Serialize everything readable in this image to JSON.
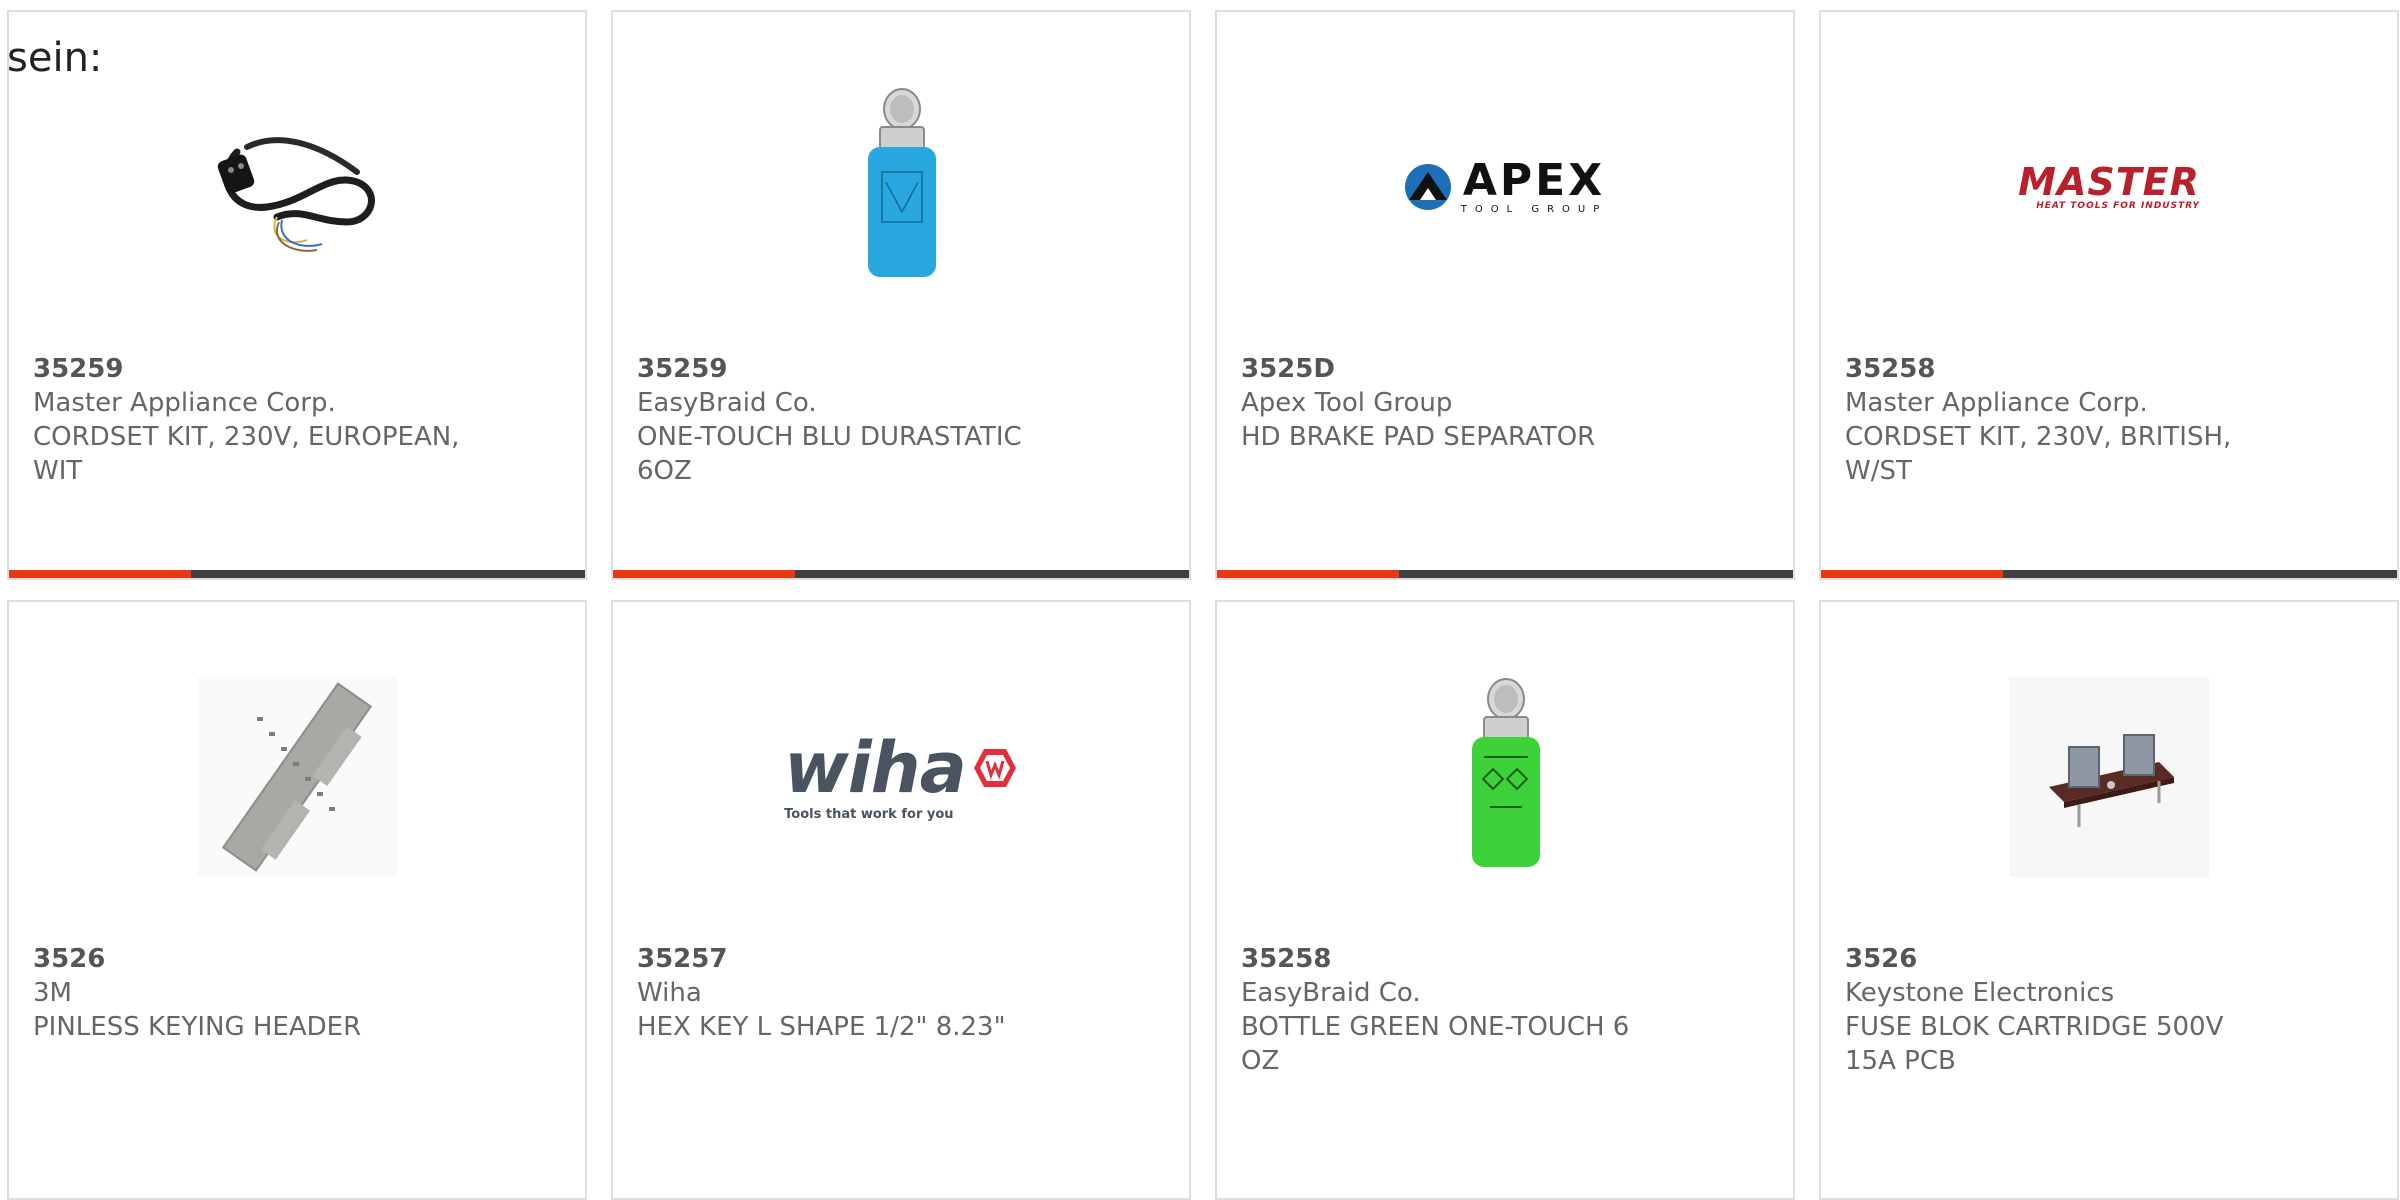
{
  "intro_text": "sein:",
  "products": [
    {
      "part": "35259",
      "maker": "Master Appliance Corp.",
      "desc": "CORDSET KIT, 230V, EUROPEAN,",
      "desc2": "WIT",
      "image": "power-cord-photo"
    },
    {
      "part": "35259",
      "maker": "EasyBraid Co.",
      "desc": "ONE-TOUCH BLU DURASTATIC",
      "desc2": "6OZ",
      "image": "blue-dispenser-bottle-photo"
    },
    {
      "part": "3525D",
      "maker": "Apex Tool Group",
      "desc": "HD BRAKE PAD SEPARATOR",
      "desc2": "",
      "image": "apex-logo",
      "logo_word": "APEX",
      "logo_sub": "TOOL GROUP"
    },
    {
      "part": "35258",
      "maker": "Master Appliance Corp.",
      "desc": "CORDSET KIT, 230V, BRITISH,",
      "desc2": "W/ST",
      "image": "master-logo",
      "logo_word": "MASTER",
      "logo_sub": "HEAT TOOLS FOR INDUSTRY"
    },
    {
      "part": "3526",
      "maker": "3M",
      "desc": "PINLESS KEYING HEADER",
      "desc2": "",
      "image": "connector-header-photo"
    },
    {
      "part": "35257",
      "maker": "Wiha",
      "desc": "HEX KEY L SHAPE 1/2\" 8.23\"",
      "desc2": "",
      "image": "wiha-logo",
      "logo_word": "wiha",
      "logo_sub": "Tools that work for you"
    },
    {
      "part": "35258",
      "maker": "EasyBraid Co.",
      "desc": "BOTTLE GREEN ONE-TOUCH 6",
      "desc2": "OZ",
      "image": "green-dispenser-bottle-photo"
    },
    {
      "part": "3526",
      "maker": "Keystone Electronics",
      "desc": "FUSE BLOK CARTRIDGE 500V",
      "desc2": "15A PCB",
      "image": "fuse-block-photo"
    }
  ],
  "colors": {
    "accent_bar": "#e83a10",
    "dark_bar": "#3d3f42",
    "card_border": "#dedede",
    "text_gray": "#666666",
    "blue_bottle": "#29a8e0",
    "green_bottle": "#3dd23a",
    "master_red": "#b8212b",
    "apex_blue": "#1d6fb8"
  }
}
